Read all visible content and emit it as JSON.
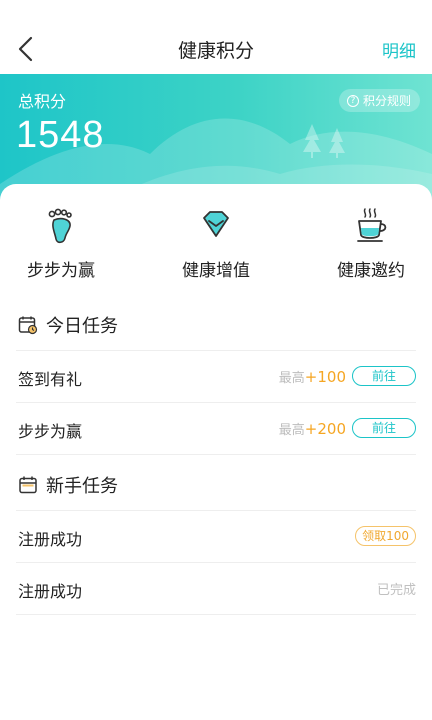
{
  "header": {
    "title": "健康积分",
    "detail_link": "明细"
  },
  "points": {
    "label": "总积分",
    "value": "1548",
    "rules_label": "积分规则"
  },
  "features": [
    {
      "label": "步步为赢",
      "icon": "footprint-icon"
    },
    {
      "label": "健康增值",
      "icon": "diamond-icon"
    },
    {
      "label": "健康邀约",
      "icon": "tea-cup-icon"
    }
  ],
  "daily": {
    "title": "今日任务",
    "tasks": [
      {
        "name": "签到有礼",
        "max_prefix": "最高",
        "max_value": "+100",
        "action": "前往"
      },
      {
        "name": "步步为赢",
        "max_prefix": "最高",
        "max_value": "+200",
        "action": "前往"
      }
    ]
  },
  "newbie": {
    "title": "新手任务",
    "tasks": [
      {
        "name": "注册成功",
        "action": "领取100"
      },
      {
        "name": "注册成功",
        "status": "已完成"
      }
    ]
  },
  "colors": {
    "accent": "#1cc4c8",
    "highlight": "#f5a623"
  }
}
